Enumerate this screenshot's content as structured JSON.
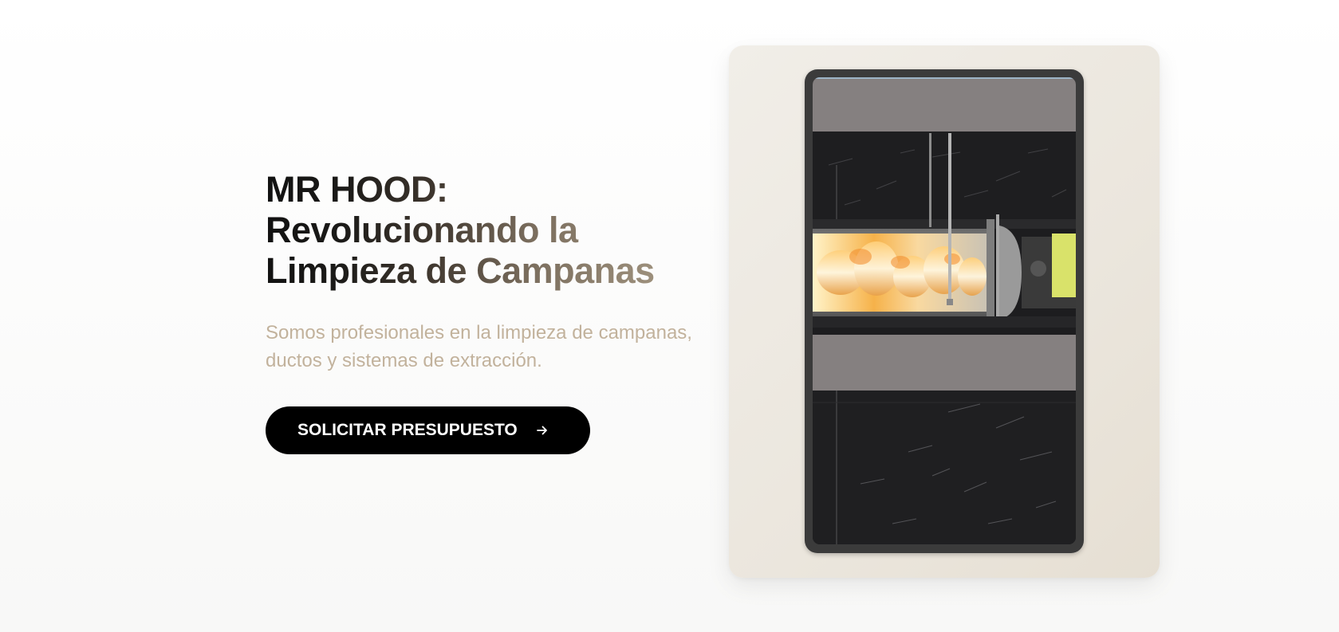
{
  "hero": {
    "title_line1": "MR HOOD:",
    "title_line2": "Revolucionando la",
    "title_line3": "Limpieza de Campanas",
    "subtitle": "Somos profesionales en la limpieza de campanas, ductos y sistemas de extracción.",
    "cta_label": "SOLICITAR PRESUPUESTO",
    "cta_icon": "arrow-right-icon"
  },
  "media": {
    "content": "video-frame-duct-fire-suppression"
  },
  "colors": {
    "title_dark": "#111111",
    "title_light": "#a89b86",
    "subtitle": "#c2b29c",
    "button_bg": "#000000",
    "button_text": "#ffffff",
    "card_bg": "#ebe6dd"
  }
}
